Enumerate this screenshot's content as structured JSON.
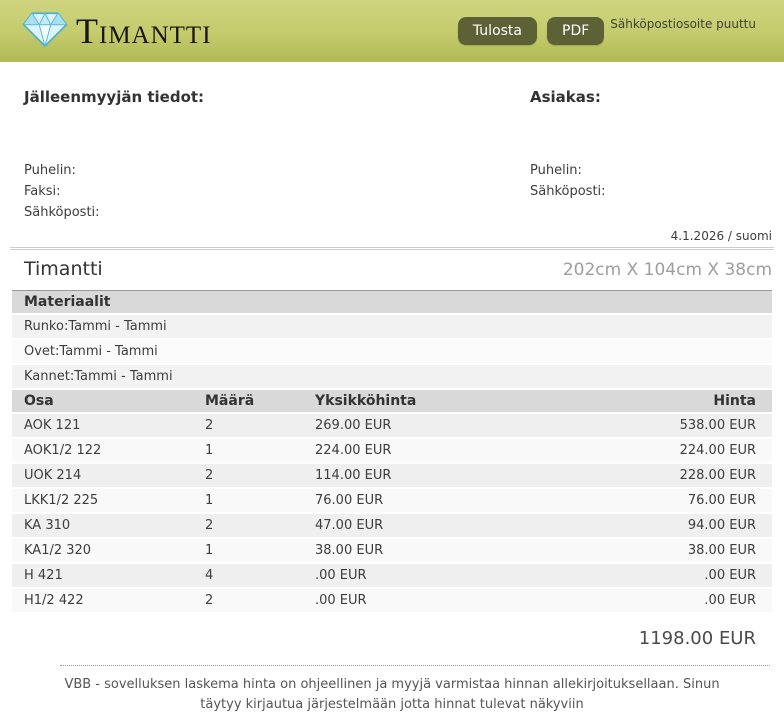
{
  "header": {
    "brand": "Timantti",
    "print_label": "Tulosta",
    "pdf_label": "PDF",
    "email_missing": "Sähköpostiosoite puuttu"
  },
  "reseller": {
    "heading": "Jälleenmyyjän tiedot:",
    "phone_label": "Puhelin:",
    "fax_label": "Faksi:",
    "email_label": "Sähköposti:"
  },
  "customer": {
    "heading": "Asiakas:",
    "phone_label": "Puhelin:",
    "email_label": "Sähköposti:"
  },
  "meta": {
    "date_text": "4.1.2026 / suomi"
  },
  "product": {
    "name": "Timantti",
    "dimensions": "202cm X 104cm X 38cm"
  },
  "materials": {
    "heading": "Materiaalit",
    "rows": [
      "Runko:Tammi - Tammi",
      "Ovet:Tammi - Tammi",
      "Kannet:Tammi - Tammi"
    ]
  },
  "parts": {
    "headers": [
      "Osa",
      "Määrä",
      "Yksikköhinta",
      "Hinta"
    ],
    "rows": [
      [
        "AOK 121",
        "2",
        "269.00 EUR",
        "538.00 EUR"
      ],
      [
        "AOK1/2 122",
        "1",
        "224.00 EUR",
        "224.00 EUR"
      ],
      [
        "UOK 214",
        "2",
        "114.00 EUR",
        "228.00 EUR"
      ],
      [
        "LKK1/2 225",
        "1",
        "76.00 EUR",
        "76.00 EUR"
      ],
      [
        "KA 310",
        "2",
        "47.00 EUR",
        "94.00 EUR"
      ],
      [
        "KA1/2 320",
        "1",
        "38.00 EUR",
        "38.00 EUR"
      ],
      [
        "H 421",
        "4",
        ".00 EUR",
        ".00 EUR"
      ],
      [
        "H1/2 422",
        "2",
        ".00 EUR",
        ".00 EUR"
      ]
    ]
  },
  "total": {
    "amount": "1198.00 EUR"
  },
  "footer": {
    "disclaimer": "VBB - sovelluksen laskema hinta on ohjeellinen ja myyjä varmistaa hinnan allekirjoituksellaan. Sinun täytyy kirjautua järjestelmään jotta hinnat tulevat näkyviin"
  },
  "colors": {
    "header_gradient_top": "#ced47f",
    "header_gradient_bottom": "#b1b954",
    "button_bg": "#5d6135",
    "table_header_bg": "#d9d9d9",
    "row_odd_bg": "#efefef",
    "row_even_bg": "#f9f9f9",
    "dims_text": "#9e9e9e"
  }
}
